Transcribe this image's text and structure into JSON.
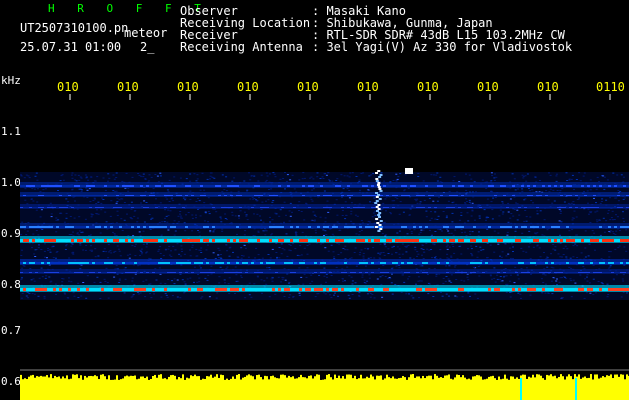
{
  "header": {
    "logo": "H R O F F T",
    "filename": "UT2507310100.pn",
    "filename_suffix": "meteor",
    "timestamp": "25.07.31 01:00",
    "page": "2_",
    "rows": [
      {
        "label": "Observer",
        "value": ": Masaki Kano"
      },
      {
        "label": "Receiving Location",
        "value": ": Shibukawa, Gunma, Japan"
      },
      {
        "label": "Receiver",
        "value": ": RTL-SDR SDR# 43dB L15 103.2MHz CW"
      },
      {
        "label": "Receiving Antenna",
        "value": ": 3el Yagi(V) Az 330 for Vladivostok"
      }
    ]
  },
  "time_axis": {
    "labels": [
      "010",
      "010",
      "010",
      "010",
      "010",
      "010",
      "010",
      "010",
      "010",
      "0110"
    ]
  },
  "freq_axis": {
    "unit": "kHz",
    "labels": [
      "1.1",
      "1.0",
      "0.9",
      "0.8",
      "0.7",
      "0.6"
    ]
  },
  "colors": {
    "background": "#000000",
    "tick_text": "#ffff00",
    "header_text": "#ffffff",
    "logo_text": "#00ff00",
    "signal_high": "#ff2000",
    "signal_mid": "#00ffff",
    "noise": "#0020a0",
    "level_bar": "#ffff00"
  }
}
